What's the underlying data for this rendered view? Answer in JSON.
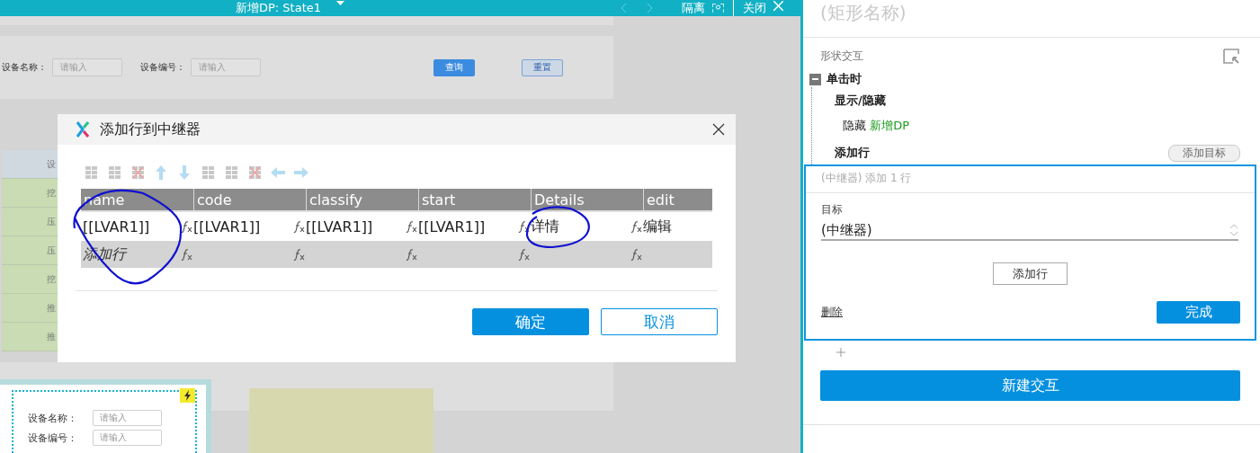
{
  "header": {
    "title": "新增DP: State1",
    "isolate": "隔离",
    "close": "关闭"
  },
  "canvas": {
    "search_panel": {
      "fields": [
        {
          "label": "设备名称：",
          "placeholder": "请输入"
        },
        {
          "label": "设备编号：",
          "placeholder": "请输入"
        }
      ],
      "buttons": [
        "查询",
        "重置"
      ]
    },
    "background_table": {
      "header": "设",
      "rows": [
        "挖",
        "压",
        "压",
        "挖",
        "推",
        "推"
      ]
    },
    "form_frame": {
      "fields": [
        {
          "label": "设备名称：",
          "placeholder": "请输入"
        },
        {
          "label": "设备编号：",
          "placeholder": "请输入"
        }
      ]
    }
  },
  "dialog": {
    "title": "添加行到中继器",
    "columns": [
      "name",
      "code",
      "classify",
      "start",
      "Details",
      "edit"
    ],
    "rows": [
      {
        "cells": [
          "[[LVAR1]]",
          "[[LVAR1]]",
          "[[LVAR1]]",
          "[[LVAR1]]",
          "详情",
          "编辑"
        ]
      }
    ],
    "add_row": "添加行",
    "ok": "确定",
    "cancel": "取消"
  },
  "panel": {
    "shape_name": "(矩形名称)",
    "section": "形状交互",
    "event": {
      "label": "单击时",
      "expanded": true,
      "actions": [
        {
          "title": "显示/隐藏",
          "verb": "隐藏",
          "target": "新增DP"
        },
        {
          "title": "添加行",
          "button": "添加目标",
          "editor": {
            "summary": "(中继器) 添加 1 行",
            "target_label": "目标",
            "target_value": "(中继器)",
            "add_row_button": "添加行",
            "delete": "删除",
            "done": "完成"
          }
        }
      ]
    },
    "new_interaction": "新建交互"
  }
}
